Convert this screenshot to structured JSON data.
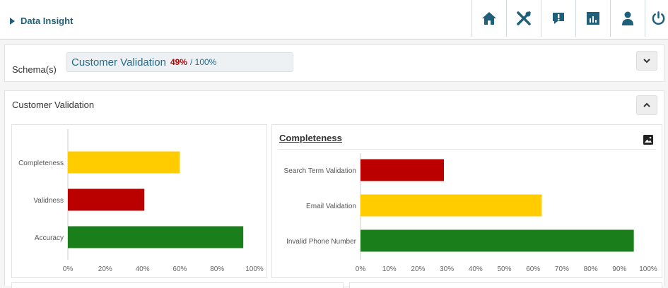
{
  "header": {
    "breadcrumb": "Data Insight",
    "toolbar": [
      {
        "name": "home-button",
        "icon": "home-icon"
      },
      {
        "name": "tools-button",
        "icon": "tools-icon"
      },
      {
        "name": "alerts-button",
        "icon": "alert-icon"
      },
      {
        "name": "reports-button",
        "icon": "bar-chart-icon"
      },
      {
        "name": "user-button",
        "icon": "user-icon"
      },
      {
        "name": "power-button",
        "icon": "power-icon"
      }
    ]
  },
  "schema": {
    "label": "Schema(s)",
    "name": "Customer Validation",
    "percent": "49%",
    "total": "/ 100%",
    "toggle_icon": "chevron-down-icon"
  },
  "section": {
    "title": "Customer Validation",
    "toggle_icon": "chevron-up-icon"
  },
  "colors": {
    "yellow": "#ffcc00",
    "red": "#bb0000",
    "green": "#1a7f1a",
    "accent": "#1f5f7a"
  },
  "chart_data": [
    {
      "type": "bar",
      "orientation": "horizontal",
      "title": "",
      "categories": [
        "Completeness",
        "Validness",
        "Accuracy"
      ],
      "values": [
        60,
        41,
        94
      ],
      "colors": [
        "#ffcc00",
        "#bb0000",
        "#1a7f1a"
      ],
      "xlim": [
        0,
        100
      ],
      "ticks": [
        "0%",
        "20%",
        "40%",
        "60%",
        "80%",
        "100%"
      ],
      "grid": false
    },
    {
      "type": "bar",
      "orientation": "horizontal",
      "title": "Completeness",
      "categories": [
        "Search Term Validation",
        "Email Validation",
        "Invalid Phone Number"
      ],
      "values": [
        29,
        63,
        95
      ],
      "colors": [
        "#bb0000",
        "#ffcc00",
        "#1a7f1a"
      ],
      "xlim": [
        0,
        100
      ],
      "ticks": [
        "0%",
        "10%",
        "20%",
        "30%",
        "40%",
        "50%",
        "60%",
        "70%",
        "80%",
        "90%",
        "100%"
      ],
      "grid": false,
      "export_icon": "image-icon"
    }
  ]
}
